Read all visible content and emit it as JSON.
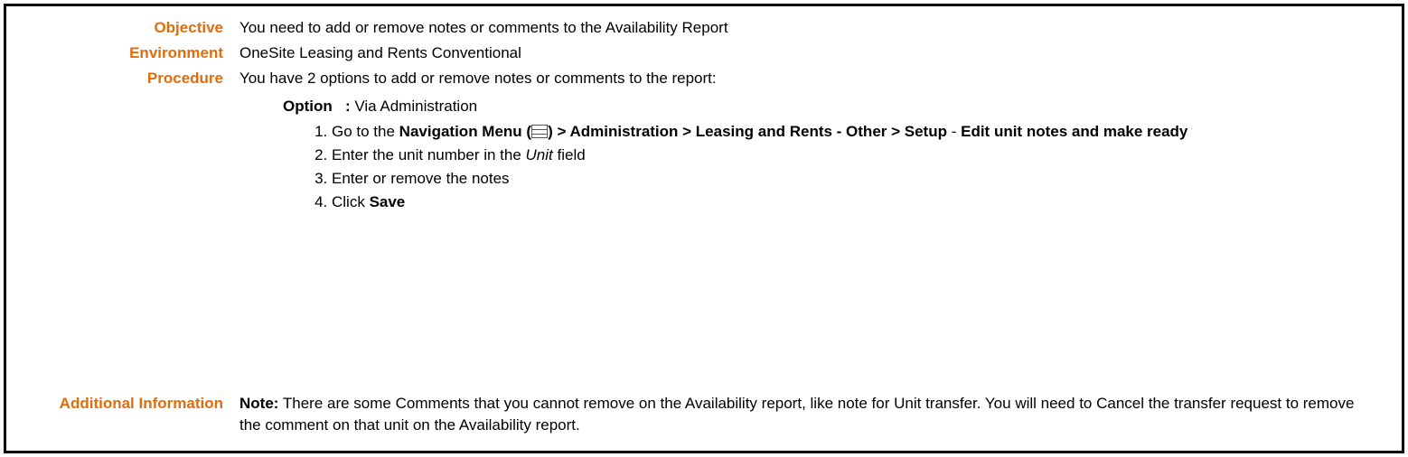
{
  "labels": {
    "objective": "Objective",
    "environment": "Environment",
    "procedure": "Procedure",
    "additional_info": "Additional Information"
  },
  "objective": "You need to add or remove notes or comments to the Availability Report",
  "environment": "OneSite Leasing and Rents Conventional",
  "procedure": {
    "intro": "You have 2 options to add or remove notes or comments to the report:",
    "option": {
      "label": "Option",
      "sep": ":",
      "title": "Via Administration",
      "steps": {
        "s1_pre": "Go to the ",
        "s1_nav1": "Navigation Menu (",
        "s1_nav2": ") > Administration > Leasing and Rents - Other > Setup",
        "s1_dash": " - ",
        "s1_nav3": "Edit unit notes and make ready",
        "s2_pre": "Enter the unit number in the ",
        "s2_field": "Unit",
        "s2_post": " field",
        "s3": "Enter or remove the notes",
        "s4_pre": "Click ",
        "s4_btn": "Save"
      }
    }
  },
  "additional_info": {
    "note_label": "Note:",
    "text": " There are some Comments that you cannot remove on the Availability report, like note for Unit transfer. You will need to Cancel the transfer request to remove the comment on that unit on the Availability report."
  }
}
